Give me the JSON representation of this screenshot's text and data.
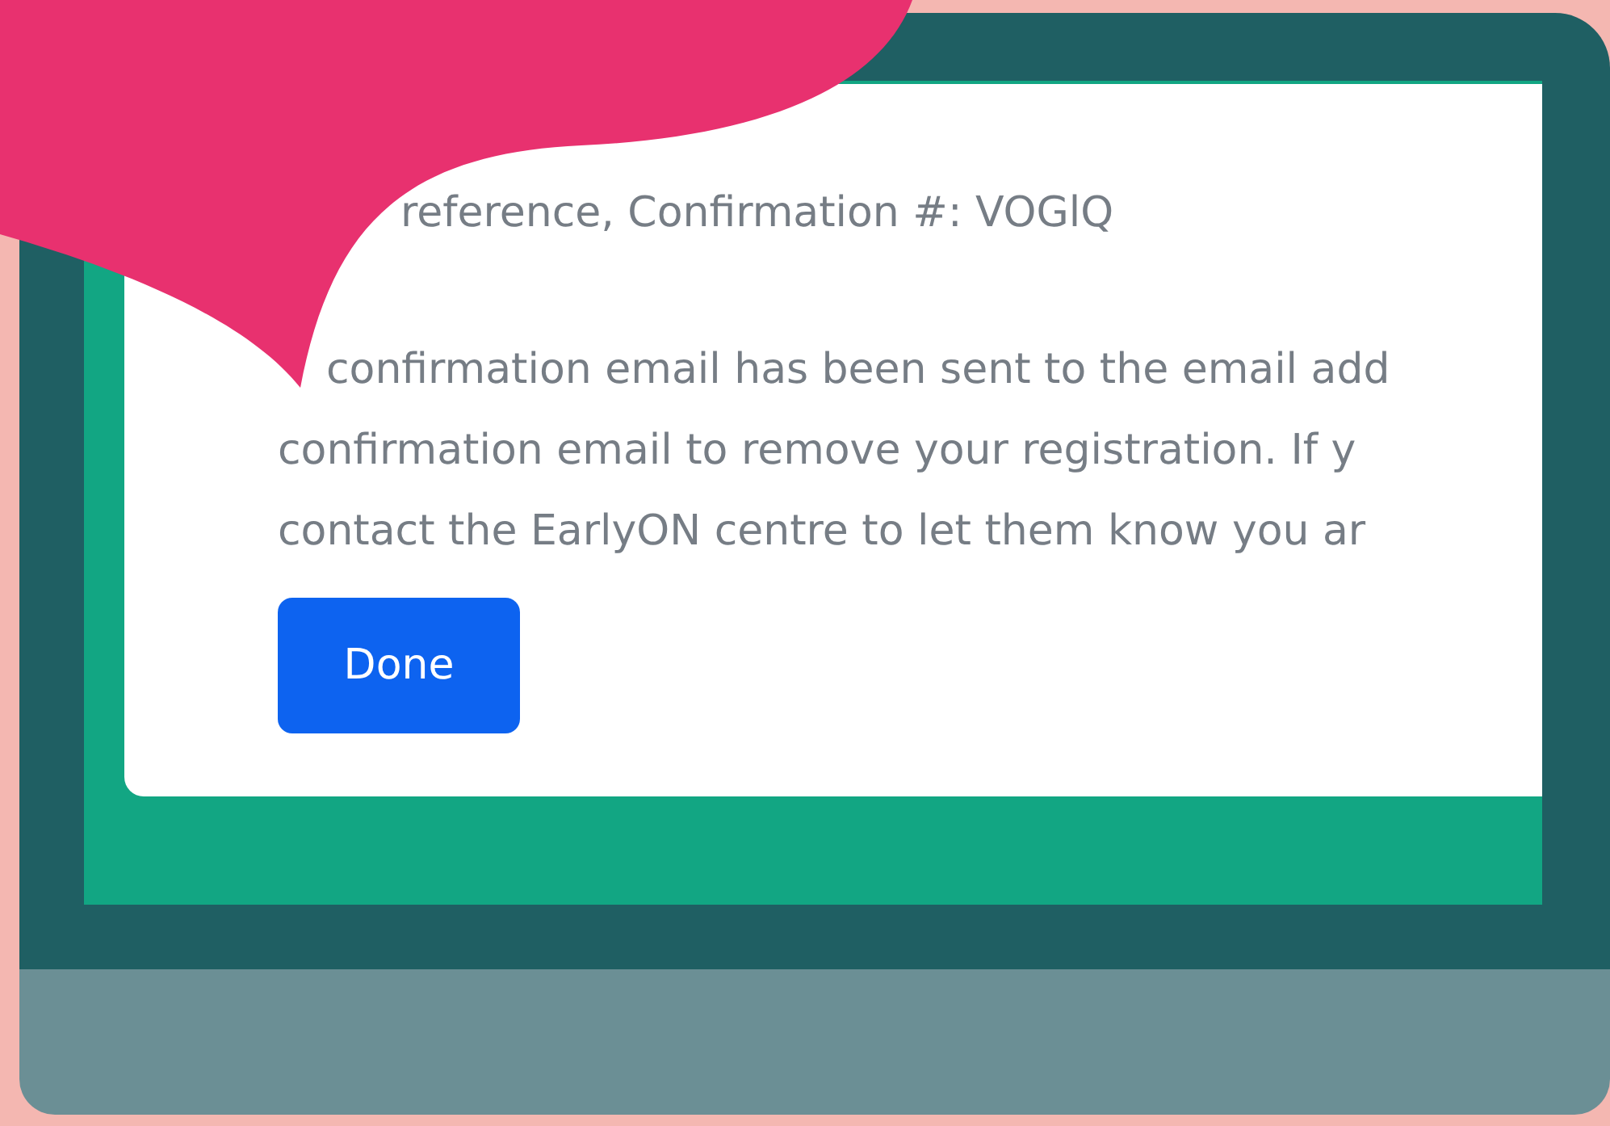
{
  "confirmation": {
    "text": "reference, Confirmation #: VOGlQ"
  },
  "message_lines": [
    "confirmation email has been sent to the email add",
    "confirmation email to remove your registration. If y",
    "contact the EarlyON centre to let them know you ar"
  ],
  "button": {
    "label": "Done"
  }
}
